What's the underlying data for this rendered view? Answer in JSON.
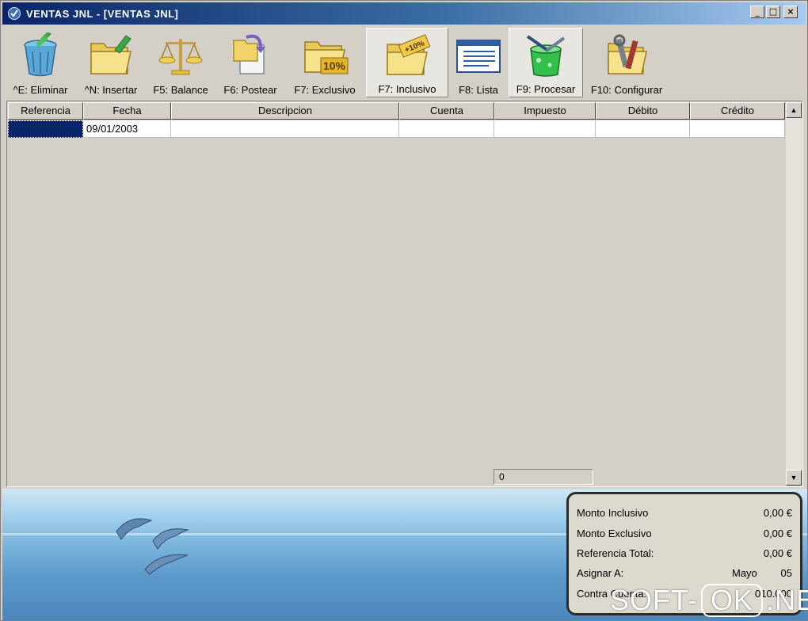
{
  "window": {
    "title": "VENTAS JNL - [VENTAS JNL]"
  },
  "toolbar": {
    "eliminar": "^E: Eliminar",
    "insertar": "^N: Insertar",
    "balance": "F5: Balance",
    "postear": "F6: Postear",
    "exclusivo": "F7: Exclusivo",
    "exclusivo_badge": "10%",
    "inclusivo": "F7: Inclusivo",
    "inclusivo_badge": "+10%",
    "lista": "F8: Lista",
    "procesar": "F9: Procesar",
    "configurar": "F10: Configurar"
  },
  "grid": {
    "headers": [
      "Referencia",
      "Fecha",
      "Descripcion",
      "Cuenta",
      "Impuesto",
      "Débito",
      "Crédito"
    ],
    "rows": [
      {
        "referencia": "",
        "fecha": "09/01/2003",
        "descripcion": "",
        "cuenta": "",
        "impuesto": "",
        "debito": "",
        "credito": ""
      }
    ],
    "counter": "0"
  },
  "summary": {
    "monto_inclusivo_label": "Monto Inclusivo",
    "monto_inclusivo_value": "0,00 €",
    "monto_exclusivo_label": "Monto Exclusivo",
    "monto_exclusivo_value": "0,00 €",
    "referencia_total_label": "Referencia Total:",
    "referencia_total_value": "0,00 €",
    "asignar_label": "Asignar A:",
    "asignar_month": "Mayo",
    "asignar_day": "05",
    "contra_label": "Contra Cuenta:",
    "contra_value": "010.000"
  },
  "watermark": {
    "left": "SOFT-",
    "mid": "OK",
    "right": ".NET"
  }
}
